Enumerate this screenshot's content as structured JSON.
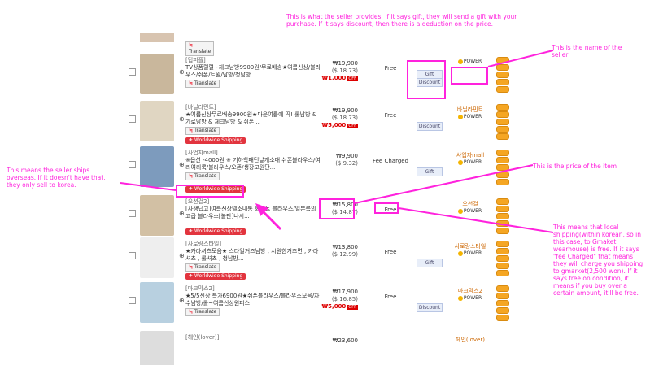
{
  "rows": [
    {
      "seller_name": "[딥퍼플]",
      "desc": "TV상품럴럴~체크남방9900원/무료배송★여름신상/블라우스/쉬폰/트윌/남방/청남방...",
      "price": "₩19,900",
      "usd": "($ 18.73)",
      "discount": "₩1,000",
      "off": "OFF",
      "shipping": "Free",
      "badges": [
        "Gift",
        "Discount"
      ],
      "translate": "Translate",
      "worldwide": false,
      "logo": "",
      "power": "POWER"
    },
    {
      "seller_name": "[바닐라민트]",
      "desc": "★여름신상무료배송9900원★다운여름에 딱! 롤남방 & 가로남방 & 체크남방 & 쉬폰...",
      "price": "₩19,900",
      "usd": "($ 18.73)",
      "discount": "₩5,000",
      "off": "OFF",
      "shipping": "Free",
      "badges": [
        "Discount"
      ],
      "translate": "Translate",
      "worldwide": false,
      "logo": "바닐라민트",
      "power": "POWER"
    },
    {
      "seller_name": "[사업자mall]",
      "desc": "※옵션 -4000원 ※ 기하학패턴날개소매 쉬폰블라우스/여리여리룩/블라우스/오픈/생장고원단...",
      "price": "₩9,900",
      "usd": "($ 9.32)",
      "discount": "",
      "off": "",
      "shipping": "Fee Charged",
      "badges": [
        "Gift"
      ],
      "translate": "Translate",
      "worldwide": true,
      "logo": "사업자mall",
      "power": "POWER"
    },
    {
      "seller_name": "[오션걸2]",
      "desc": "[사생딥고]여름신상델소내통 화이트 블라우스/일본룩의 고급 블라우스[불판]나시...",
      "price": "₩15,800",
      "usd": "($ 14.87)",
      "discount": "",
      "off": "",
      "shipping": "Free",
      "badges": [],
      "translate": "",
      "worldwide": true,
      "logo": "오션걸",
      "power": "POWER"
    },
    {
      "seller_name": "[사로랑스타일]",
      "desc": "★카라셔츠모음★ 스타일거즈남방 , 시원한거즈면 , 카라셔츠 , 롤셔츠 , 청남방...",
      "price": "₩13,800",
      "usd": "($ 12.99)",
      "discount": "",
      "off": "",
      "shipping": "Free",
      "badges": [
        "Gift"
      ],
      "translate": "Translate",
      "worldwide": true,
      "logo": "사로랑스타일",
      "power": "POWER"
    },
    {
      "seller_name": "[마크막스2]",
      "desc": "★5/5신상 특가6900원★쉬폰블라우스/블라우스모음/자수남방/롤~여름신상원피스",
      "price": "₩17,900",
      "usd": "($ 16.85)",
      "discount": "₩5,000",
      "off": "OFF",
      "shipping": "Free",
      "badges": [
        "Discount"
      ],
      "translate": "Translate",
      "worldwide": true,
      "logo": "마크막스2",
      "power": "POWER"
    },
    {
      "seller_name": "[헤인(lover)]",
      "desc": "",
      "price": "₩23,600",
      "usd": "",
      "discount": "",
      "off": "",
      "shipping": "",
      "badges": [],
      "translate": "",
      "worldwide": true,
      "logo": "헤인(lover)",
      "power": ""
    }
  ],
  "worldwide_label": "Worldwide Shipping",
  "top_translate": "Translate",
  "notes": {
    "seller_provides": "This is what the seller provides. If it says gift, they will send a gift with your purchase. If it says discount, then there is a deduction on the price.",
    "seller_name": "This is the name of the seller",
    "ships_overseas": "This means the seller ships overseas. If it doesn't have that, they only sell to korea.",
    "price": "This is the price of the item",
    "shipping": "This means that local shipping(within korean, so in this case, to Gmaket wearhouse) is free. If it says \"fee Charged\" that means they will charge you shipping to gmarket(2,500 won). If it says free on condition, it means if you buy over a certain amount, it'll be free."
  },
  "colors": {
    "annotation": "#ff22dd",
    "badge_red": "#e2343e",
    "coin": "#f5a623"
  }
}
